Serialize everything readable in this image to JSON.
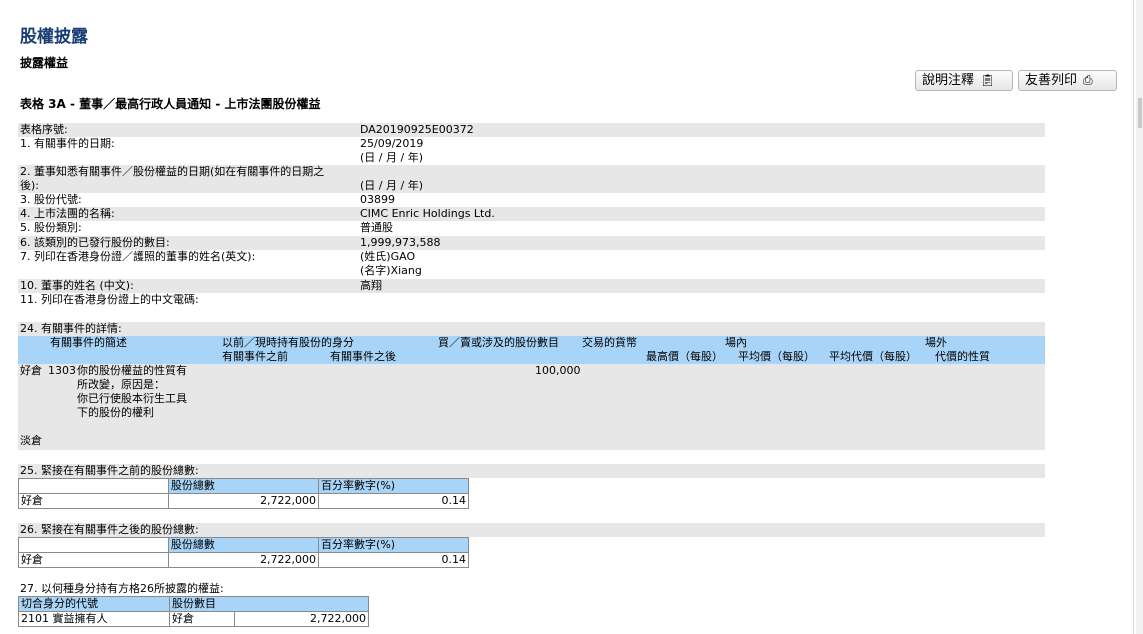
{
  "page": {
    "title": "股權披露",
    "subtitle": "披露權益",
    "form_title": "表格 3A - 董事／最高行政人員通知 - 上市法團股份權益"
  },
  "toolbar": {
    "explain_label": "說明注釋",
    "print_label": "友善列印",
    "explain_icon": "clipboard-icon",
    "print_icon": "printer-icon"
  },
  "fields": {
    "serial_label": "表格序號:",
    "serial_value": "DA20190925E00372",
    "f1_label": "1. 有關事件的日期:",
    "f1_value": "25/09/2019",
    "f1_format": "(日 / 月 / 年)",
    "f2_label_line1": "2. 董事知悉有關事件／股份權益的日期(如在有關事件的日期之",
    "f2_label_line2": "後):",
    "f2_value": "(日 / 月 / 年)",
    "f3_label": "3. 股份代號:",
    "f3_value": "03899",
    "f4_label": "4. 上市法團的名稱:",
    "f4_value": "CIMC Enric Holdings Ltd.",
    "f5_label": "5. 股份類別:",
    "f5_value": "普通股",
    "f6_label": "6. 該類別的已發行股份的數目:",
    "f6_value": "1,999,973,588",
    "f7_label": "7. 列印在香港身份證／護照的董事的姓名(英文):",
    "f7_value1": "(姓氏)GAO",
    "f7_value2": "(名字)Xiang",
    "f10_label": "10. 董事的姓名 (中文):",
    "f10_value": "高翔",
    "f11_label": "11. 列印在香港身份證上的中文電碼:"
  },
  "section24": {
    "label": "24. 有關事件的詳情:",
    "headers": {
      "desc": "有關事件的簡述",
      "capacity": "以前／現時持有股份的身分",
      "before": "有關事件之前",
      "after": "有關事件之後",
      "shares": "買／賣或涉及的股份數目",
      "currency": "交易的貨幣",
      "onexch": "場內",
      "high": "最高價（每股）",
      "avg": "平均價（每股）",
      "avg_consideration": "平均代價（每股）",
      "offexch": "場外",
      "nature": "代價的性質"
    },
    "long": {
      "position": "好倉",
      "code": "1303",
      "desc_lines": [
        "你的股份權益的性質有",
        "所改變，原因是：",
        "你已行使股本衍生工具",
        "下的股份的權利"
      ],
      "shares": "100,000"
    },
    "short_position": "淡倉"
  },
  "section25": {
    "label": "25. 緊接在有關事件之前的股份總數:",
    "col_shares": "股份總數",
    "col_pct": "百分率數字(%)",
    "row_label": "好倉",
    "shares": "2,722,000",
    "pct": "0.14"
  },
  "section26": {
    "label": "26. 緊接在有關事件之後的股份總數:",
    "col_shares": "股份總數",
    "col_pct": "百分率數字(%)",
    "row_label": "好倉",
    "shares": "2,722,000",
    "pct": "0.14"
  },
  "section27": {
    "label": "27. 以何種身分持有方格26所披露的權益:",
    "col_code": "切合身分的代號",
    "col_shares": "股份數目",
    "code": "2101 實益擁有人",
    "position": "好倉",
    "shares": "2,722,000"
  }
}
